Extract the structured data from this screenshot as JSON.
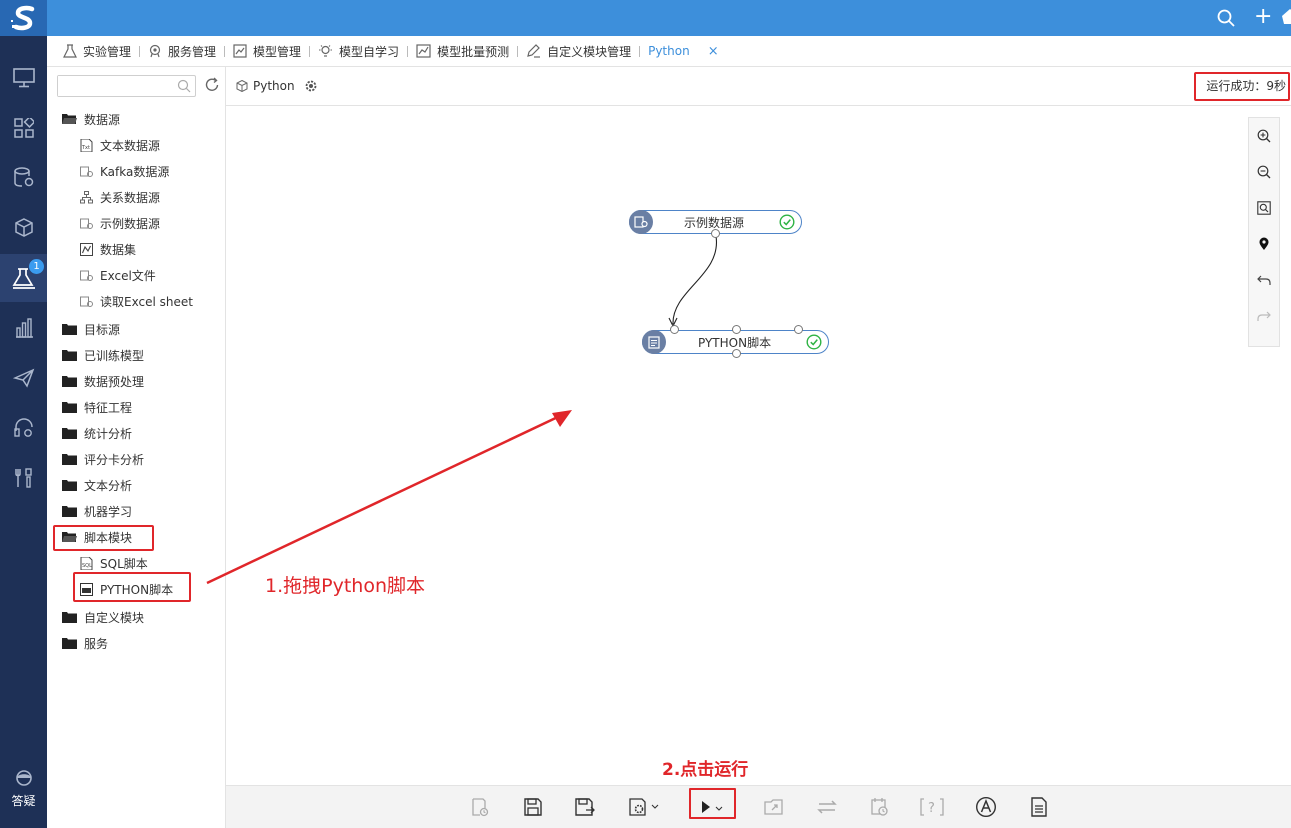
{
  "rail": {
    "badge": "1",
    "help_label": "答疑"
  },
  "tabs": [
    {
      "label": "实验管理"
    },
    {
      "label": "服务管理"
    },
    {
      "label": "模型管理"
    },
    {
      "label": "模型自学习"
    },
    {
      "label": "模型批量预测"
    },
    {
      "label": "自定义模块管理"
    },
    {
      "label": "Python",
      "active": true
    }
  ],
  "tab_close": "×",
  "sidepanel": {
    "search_placeholder": "",
    "tree": {
      "datasource": {
        "label": "数据源",
        "children": [
          "文本数据源",
          "Kafka数据源",
          "关系数据源",
          "示例数据源",
          "数据集",
          "Excel文件",
          "读取Excel sheet"
        ]
      },
      "folders_mid": [
        "目标源",
        "已训练模型",
        "数据预处理",
        "特征工程",
        "统计分析",
        "评分卡分析",
        "文本分析",
        "机器学习"
      ],
      "script": {
        "label": "脚本模块",
        "children": [
          "SQL脚本",
          "PYTHON脚本"
        ]
      },
      "folders_end": [
        "自定义模块",
        "服务"
      ]
    }
  },
  "canvas": {
    "title": "Python",
    "run_status": "运行成功：9秒",
    "nodes": [
      {
        "label": "示例数据源",
        "status": "success"
      },
      {
        "label": "PYTHON脚本",
        "status": "success"
      }
    ]
  },
  "annotations": {
    "drag_hint": "1.拖拽Python脚本",
    "run_hint": "2.点击运行"
  },
  "colors": {
    "topbar": "#3d8fdb",
    "rail": "#1e3056",
    "accent": "#3d8fdb",
    "annotation_red": "#e0262a",
    "success_green": "#2fb344"
  }
}
